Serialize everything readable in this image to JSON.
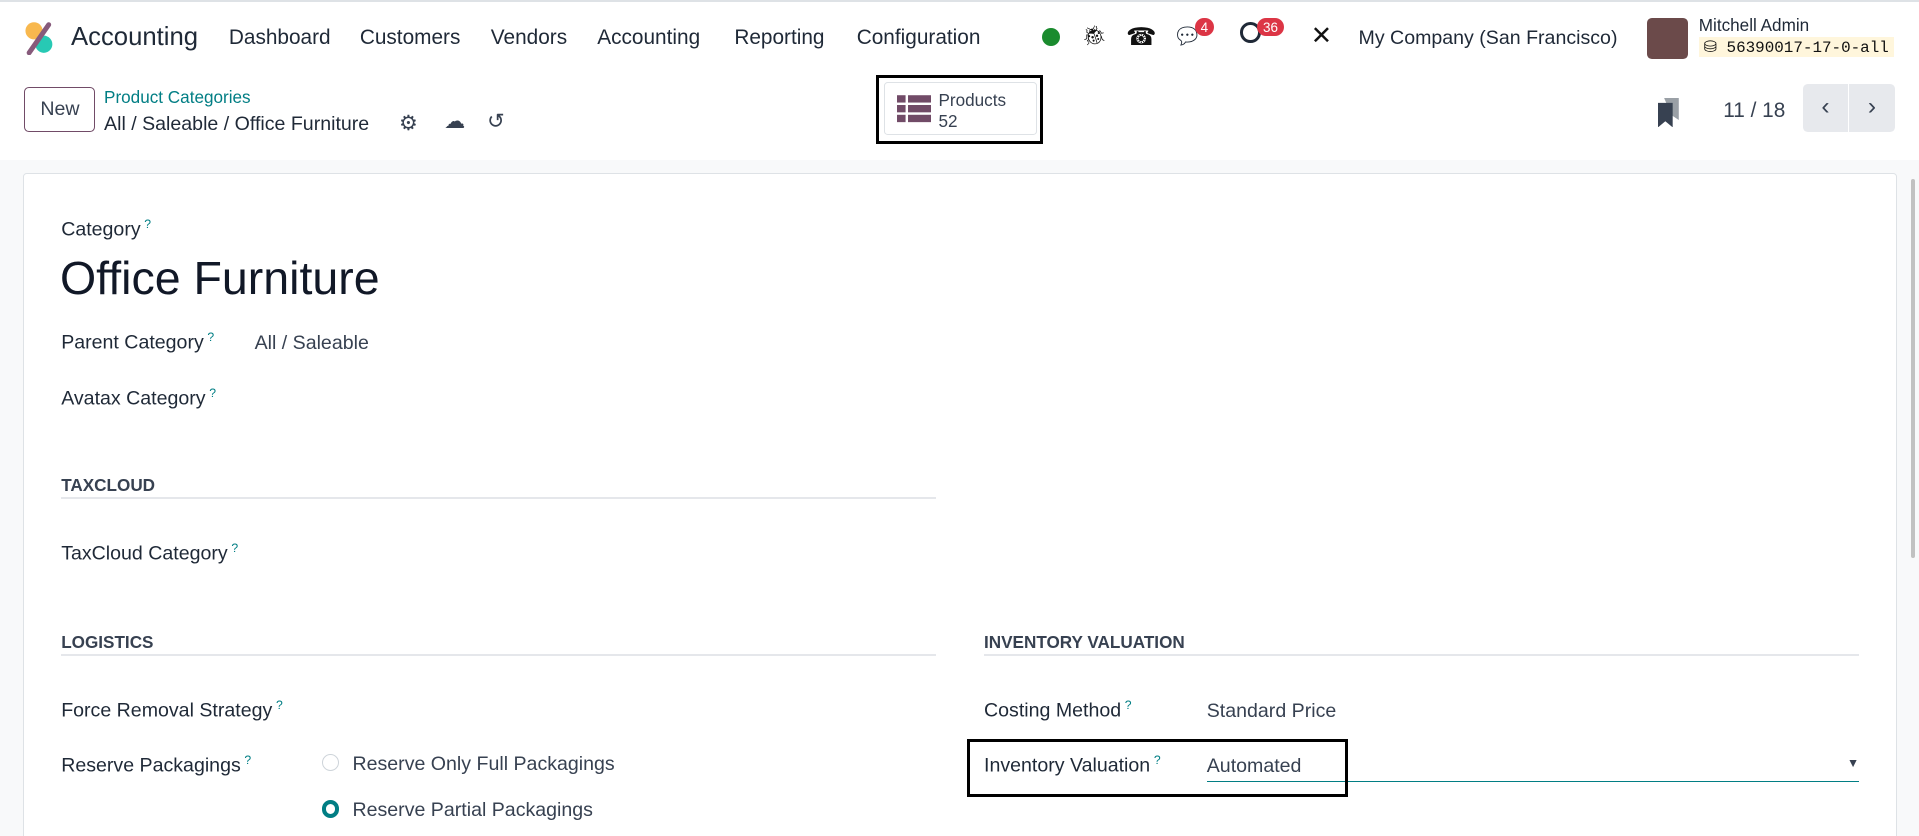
{
  "navbar": {
    "app_name": "Accounting",
    "menu": [
      "Dashboard",
      "Customers",
      "Vendors",
      "Accounting",
      "Reporting",
      "Configuration"
    ],
    "chat_badge": "4",
    "activity_badge": "36",
    "company": "My Company (San Francisco)",
    "user_name": "Mitchell Admin",
    "database": "56390017-17-0-all",
    "status_color": "#1a8b2e"
  },
  "control": {
    "new_label": "New",
    "breadcrumb_parent": "Product Categories",
    "breadcrumb_current": "All / Saleable / Office Furniture",
    "smart_button": {
      "label": "Products",
      "count": "52"
    },
    "pager": "11 / 18"
  },
  "form": {
    "category_label": "Category",
    "name": "Office Furniture",
    "parent_label": "Parent Category",
    "parent_value": "All / Saleable",
    "avatax_label": "Avatax Category",
    "taxcloud_section": "TAXCLOUD",
    "taxcloud_label": "TaxCloud Category",
    "logistics_section": "LOGISTICS",
    "removal_label": "Force Removal Strategy",
    "reserve_label": "Reserve Packagings",
    "reserve_options": [
      {
        "label": "Reserve Only Full Packagings",
        "selected": false
      },
      {
        "label": "Reserve Partial Packagings",
        "selected": true
      }
    ],
    "valuation_section": "INVENTORY VALUATION",
    "costing_label": "Costing Method",
    "costing_value": "Standard Price",
    "valuation_label": "Inventory Valuation",
    "valuation_value": "Automated",
    "help_mark": "?"
  },
  "colors": {
    "accent": "#017e84",
    "brand": "#714b67"
  }
}
